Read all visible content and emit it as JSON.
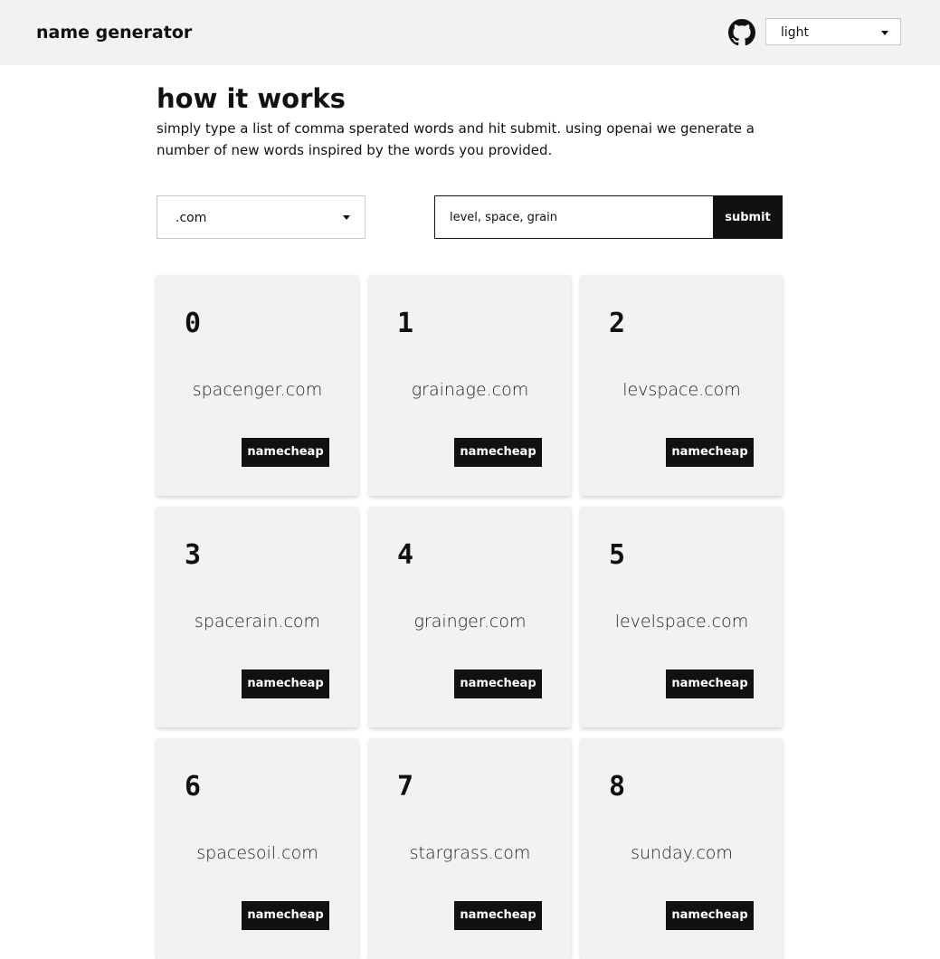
{
  "header": {
    "brand": "name generator",
    "github_icon": "github-icon",
    "theme_value": "light"
  },
  "intro": {
    "title": "how it works",
    "description": "simply type a list of comma sperated words and hit submit. using openai we generate a number of new words inspired by the words you provided."
  },
  "form": {
    "tld_value": ".com",
    "words_value": "level, space, grain",
    "submit_label": "submit"
  },
  "results": [
    {
      "index": "0",
      "name": "spacenger.com",
      "button": "namecheap"
    },
    {
      "index": "1",
      "name": "grainage.com",
      "button": "namecheap"
    },
    {
      "index": "2",
      "name": "levspace.com",
      "button": "namecheap"
    },
    {
      "index": "3",
      "name": "spacerain.com",
      "button": "namecheap"
    },
    {
      "index": "4",
      "name": "grainger.com",
      "button": "namecheap"
    },
    {
      "index": "5",
      "name": "levelspace.com",
      "button": "namecheap"
    },
    {
      "index": "6",
      "name": "spacesoil.com",
      "button": "namecheap"
    },
    {
      "index": "7",
      "name": "stargrass.com",
      "button": "namecheap"
    },
    {
      "index": "8",
      "name": "sunday.com",
      "button": "namecheap"
    }
  ]
}
